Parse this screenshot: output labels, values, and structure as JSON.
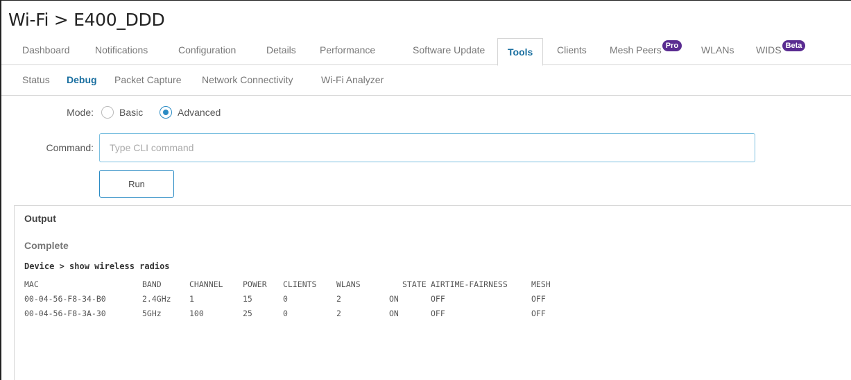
{
  "title": "Wi-Fi > E400_DDD",
  "tabs": [
    {
      "label": "Dashboard"
    },
    {
      "label": "Notifications"
    },
    {
      "label": "Configuration"
    },
    {
      "label": "Details"
    },
    {
      "label": "Performance"
    },
    {
      "label": "Software Update"
    },
    {
      "label": "Tools",
      "active": true
    },
    {
      "label": "Clients"
    },
    {
      "label": "Mesh Peers",
      "badge": "Pro"
    },
    {
      "label": "WLANs"
    },
    {
      "label": "WIDS",
      "badge": "Beta"
    }
  ],
  "subtabs": [
    {
      "label": "Status"
    },
    {
      "label": "Debug",
      "active": true
    },
    {
      "label": "Packet Capture"
    },
    {
      "label": "Network Connectivity"
    },
    {
      "label": "Wi-Fi Analyzer"
    }
  ],
  "form": {
    "mode_label": "Mode:",
    "mode_options": [
      "Basic",
      "Advanced"
    ],
    "mode_selected": "Advanced",
    "command_label": "Command:",
    "command_placeholder": "Type CLI command",
    "command_value": "",
    "run_label": "Run"
  },
  "output": {
    "title": "Output",
    "status": "Complete",
    "command_line": "Device > show wireless radios",
    "columns": [
      "MAC",
      "BAND",
      "CHANNEL",
      "POWER",
      "CLIENTS",
      "WLANS",
      "STATE",
      "AIRTIME-FAIRNESS",
      "MESH"
    ],
    "rows": [
      [
        "00-04-56-F8-34-B0",
        "2.4GHz",
        "1",
        "15",
        "0",
        "2",
        "ON",
        "OFF",
        "OFF"
      ],
      [
        "00-04-56-F8-3A-30",
        "5GHz",
        "100",
        "25",
        "0",
        "2",
        "ON",
        "OFF",
        "OFF"
      ]
    ]
  },
  "colors": {
    "accent": "#1a6fa0",
    "badge": "#5a2c91",
    "input_border": "#7cc0e0"
  }
}
